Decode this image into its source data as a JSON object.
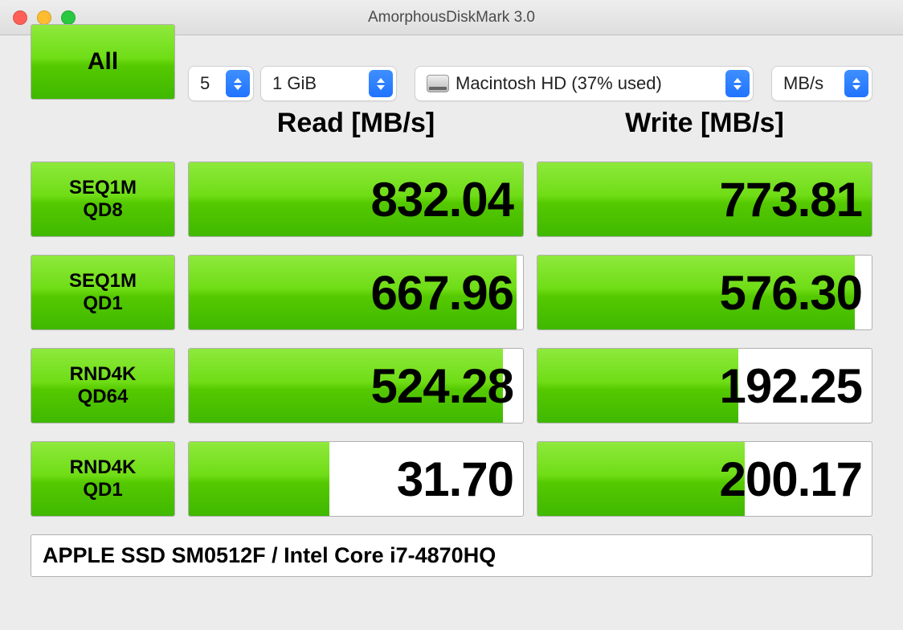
{
  "window": {
    "title": "AmorphousDiskMark 3.0"
  },
  "controls": {
    "all_label": "All",
    "runs": "5",
    "size": "1 GiB",
    "target": "Macintosh HD (37% used)",
    "unit": "MB/s"
  },
  "headers": {
    "read": "Read [MB/s]",
    "write": "Write [MB/s]"
  },
  "tests": [
    {
      "name1": "SEQ1M",
      "name2": "QD8",
      "read": "832.04",
      "write": "773.81",
      "read_pct": 100,
      "write_pct": 100
    },
    {
      "name1": "SEQ1M",
      "name2": "QD1",
      "read": "667.96",
      "write": "576.30",
      "read_pct": 98,
      "write_pct": 95
    },
    {
      "name1": "RND4K",
      "name2": "QD64",
      "read": "524.28",
      "write": "192.25",
      "read_pct": 94,
      "write_pct": 60
    },
    {
      "name1": "RND4K",
      "name2": "QD1",
      "read": "31.70",
      "write": "200.17",
      "read_pct": 42,
      "write_pct": 62
    }
  ],
  "device": "APPLE SSD SM0512F / Intel Core i7-4870HQ",
  "chart_data": {
    "type": "bar",
    "title": "AmorphousDiskMark 3.0 — Macintosh HD",
    "categories": [
      "SEQ1M QD8",
      "SEQ1M QD1",
      "RND4K QD64",
      "RND4K QD1"
    ],
    "series": [
      {
        "name": "Read [MB/s]",
        "values": [
          832.04,
          667.96,
          524.28,
          31.7
        ]
      },
      {
        "name": "Write [MB/s]",
        "values": [
          773.81,
          576.3,
          192.25,
          200.17
        ]
      }
    ],
    "ylabel": "MB/s"
  }
}
